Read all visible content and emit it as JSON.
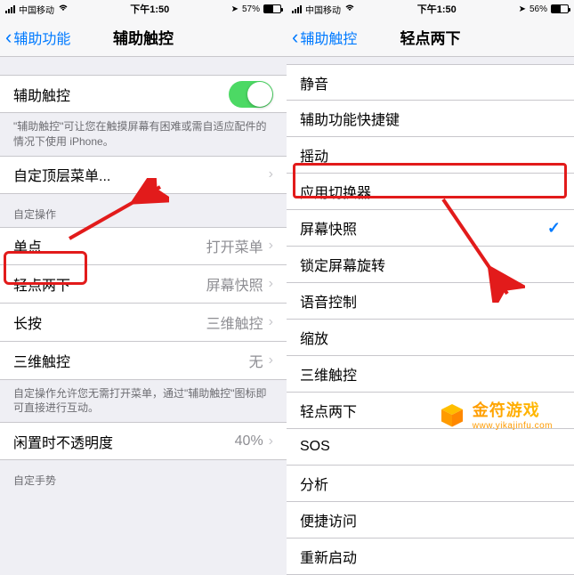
{
  "left": {
    "status": {
      "carrier": "中国移动",
      "time": "下午1:50",
      "battery_pct": "57%"
    },
    "nav": {
      "back": "辅助功能",
      "title": "辅助触控"
    },
    "toggle_label": "辅助触控",
    "toggle_footer": "\"辅助触控\"可让您在触摸屏幕有困难或需自适应配件的情况下使用 iPhone。",
    "customize_menu": "自定顶层菜单...",
    "section_actions": "自定操作",
    "actions": {
      "single": {
        "label": "单点",
        "value": "打开菜单"
      },
      "double": {
        "label": "轻点两下",
        "value": "屏幕快照"
      },
      "long": {
        "label": "长按",
        "value": "三维触控"
      },
      "threeD": {
        "label": "三维触控",
        "value": "无"
      }
    },
    "actions_footer": "自定操作允许您无需打开菜单，通过\"辅助触控\"图标即可直接进行互动。",
    "idle_opacity": {
      "label": "闲置时不透明度",
      "value": "40%"
    },
    "section_gestures": "自定手势"
  },
  "right": {
    "status": {
      "carrier": "中国移动",
      "time": "下午1:50",
      "battery_pct": "56%"
    },
    "nav": {
      "back": "辅助触控",
      "title": "轻点两下"
    },
    "options": [
      "静音",
      "辅助功能快捷键",
      "摇动",
      "应用切换器",
      "屏幕快照",
      "锁定屏幕旋转",
      "语音控制",
      "缩放",
      "三维触控",
      "轻点两下",
      "SOS",
      "分析",
      "便捷访问",
      "重新启动"
    ],
    "selected_index": 4
  },
  "watermark": {
    "title": "金符游戏",
    "url": "www.yikajinfu.com"
  }
}
